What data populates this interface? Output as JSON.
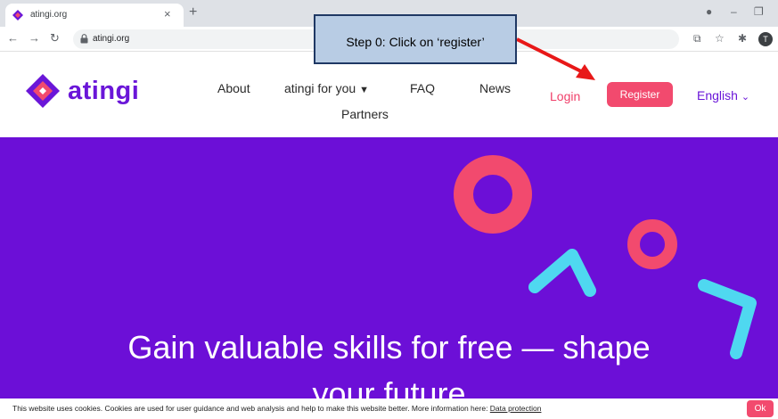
{
  "browser": {
    "tab_title": "atingi.org",
    "tab_close": "×",
    "new_tab": "+",
    "url": "atingi.org",
    "avatar_initial": "T"
  },
  "site": {
    "logo_text": "atingi",
    "nav": {
      "about": "About",
      "for_you": "atingi for you",
      "faq": "FAQ",
      "news": "News",
      "partners": "Partners"
    },
    "login": "Login",
    "register": "Register",
    "language": "English"
  },
  "hero": {
    "title_line1": "Gain valuable skills for free — shape",
    "title_line2": "your future"
  },
  "annotation": {
    "text": "Step 0: Click on ‘register’"
  },
  "cookie": {
    "text": "This website uses cookies. Cookies are used for user guidance and web analysis and help to make this website better. More information here: ",
    "link": "Data protection",
    "ok": "Ok"
  },
  "colors": {
    "brand_purple": "#6c0fd7",
    "accent_pink": "#f24a6e",
    "accent_cyan": "#4fd8f0"
  }
}
